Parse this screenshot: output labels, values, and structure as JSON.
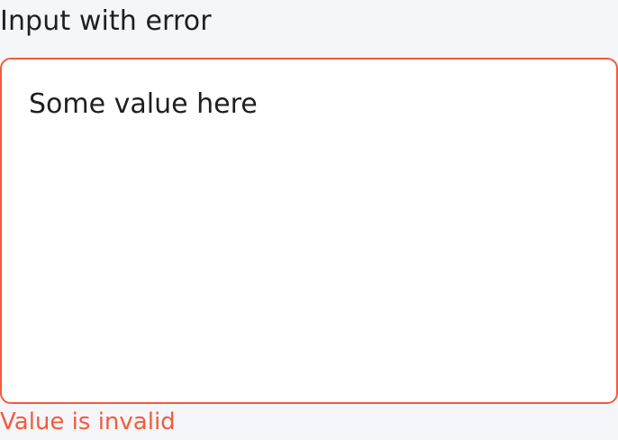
{
  "field": {
    "label": "Input with error",
    "value": "Some value here",
    "error": "Value is invalid"
  },
  "colors": {
    "background": "#f5f6f9",
    "error": "#f25c3c",
    "text": "#1f1f1f",
    "surface": "#ffffff"
  }
}
